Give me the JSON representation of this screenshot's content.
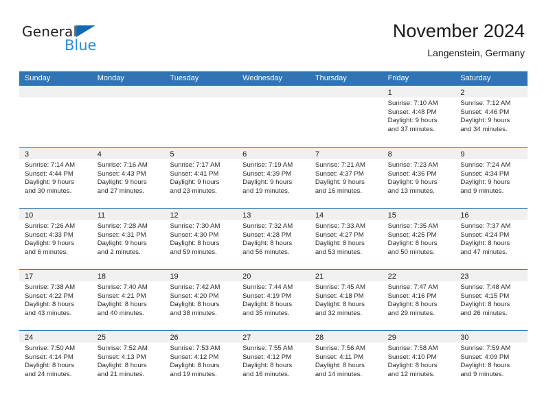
{
  "brand": {
    "word_one": "General",
    "word_two": "Blue"
  },
  "header": {
    "title": "November 2024",
    "location": "Langenstein, Germany"
  },
  "colors": {
    "header_blue": "#3174b4",
    "brand_blue": "#2e8bd4",
    "logo_triangle": "#1369b0",
    "day_band_gray": "#f0f0f0"
  },
  "weekdays": [
    "Sunday",
    "Monday",
    "Tuesday",
    "Wednesday",
    "Thursday",
    "Friday",
    "Saturday"
  ],
  "weeks": [
    [
      {
        "day": "",
        "lines": []
      },
      {
        "day": "",
        "lines": []
      },
      {
        "day": "",
        "lines": []
      },
      {
        "day": "",
        "lines": []
      },
      {
        "day": "",
        "lines": []
      },
      {
        "day": "1",
        "lines": [
          "Sunrise: 7:10 AM",
          "Sunset: 4:48 PM",
          "Daylight: 9 hours",
          "and 37 minutes."
        ]
      },
      {
        "day": "2",
        "lines": [
          "Sunrise: 7:12 AM",
          "Sunset: 4:46 PM",
          "Daylight: 9 hours",
          "and 34 minutes."
        ]
      }
    ],
    [
      {
        "day": "3",
        "lines": [
          "Sunrise: 7:14 AM",
          "Sunset: 4:44 PM",
          "Daylight: 9 hours",
          "and 30 minutes."
        ]
      },
      {
        "day": "4",
        "lines": [
          "Sunrise: 7:16 AM",
          "Sunset: 4:43 PM",
          "Daylight: 9 hours",
          "and 27 minutes."
        ]
      },
      {
        "day": "5",
        "lines": [
          "Sunrise: 7:17 AM",
          "Sunset: 4:41 PM",
          "Daylight: 9 hours",
          "and 23 minutes."
        ]
      },
      {
        "day": "6",
        "lines": [
          "Sunrise: 7:19 AM",
          "Sunset: 4:39 PM",
          "Daylight: 9 hours",
          "and 19 minutes."
        ]
      },
      {
        "day": "7",
        "lines": [
          "Sunrise: 7:21 AM",
          "Sunset: 4:37 PM",
          "Daylight: 9 hours",
          "and 16 minutes."
        ]
      },
      {
        "day": "8",
        "lines": [
          "Sunrise: 7:23 AM",
          "Sunset: 4:36 PM",
          "Daylight: 9 hours",
          "and 13 minutes."
        ]
      },
      {
        "day": "9",
        "lines": [
          "Sunrise: 7:24 AM",
          "Sunset: 4:34 PM",
          "Daylight: 9 hours",
          "and 9 minutes."
        ]
      }
    ],
    [
      {
        "day": "10",
        "lines": [
          "Sunrise: 7:26 AM",
          "Sunset: 4:33 PM",
          "Daylight: 9 hours",
          "and 6 minutes."
        ]
      },
      {
        "day": "11",
        "lines": [
          "Sunrise: 7:28 AM",
          "Sunset: 4:31 PM",
          "Daylight: 9 hours",
          "and 2 minutes."
        ]
      },
      {
        "day": "12",
        "lines": [
          "Sunrise: 7:30 AM",
          "Sunset: 4:30 PM",
          "Daylight: 8 hours",
          "and 59 minutes."
        ]
      },
      {
        "day": "13",
        "lines": [
          "Sunrise: 7:32 AM",
          "Sunset: 4:28 PM",
          "Daylight: 8 hours",
          "and 56 minutes."
        ]
      },
      {
        "day": "14",
        "lines": [
          "Sunrise: 7:33 AM",
          "Sunset: 4:27 PM",
          "Daylight: 8 hours",
          "and 53 minutes."
        ]
      },
      {
        "day": "15",
        "lines": [
          "Sunrise: 7:35 AM",
          "Sunset: 4:25 PM",
          "Daylight: 8 hours",
          "and 50 minutes."
        ]
      },
      {
        "day": "16",
        "lines": [
          "Sunrise: 7:37 AM",
          "Sunset: 4:24 PM",
          "Daylight: 8 hours",
          "and 47 minutes."
        ]
      }
    ],
    [
      {
        "day": "17",
        "lines": [
          "Sunrise: 7:38 AM",
          "Sunset: 4:22 PM",
          "Daylight: 8 hours",
          "and 43 minutes."
        ]
      },
      {
        "day": "18",
        "lines": [
          "Sunrise: 7:40 AM",
          "Sunset: 4:21 PM",
          "Daylight: 8 hours",
          "and 40 minutes."
        ]
      },
      {
        "day": "19",
        "lines": [
          "Sunrise: 7:42 AM",
          "Sunset: 4:20 PM",
          "Daylight: 8 hours",
          "and 38 minutes."
        ]
      },
      {
        "day": "20",
        "lines": [
          "Sunrise: 7:44 AM",
          "Sunset: 4:19 PM",
          "Daylight: 8 hours",
          "and 35 minutes."
        ]
      },
      {
        "day": "21",
        "lines": [
          "Sunrise: 7:45 AM",
          "Sunset: 4:18 PM",
          "Daylight: 8 hours",
          "and 32 minutes."
        ]
      },
      {
        "day": "22",
        "lines": [
          "Sunrise: 7:47 AM",
          "Sunset: 4:16 PM",
          "Daylight: 8 hours",
          "and 29 minutes."
        ]
      },
      {
        "day": "23",
        "lines": [
          "Sunrise: 7:48 AM",
          "Sunset: 4:15 PM",
          "Daylight: 8 hours",
          "and 26 minutes."
        ]
      }
    ],
    [
      {
        "day": "24",
        "lines": [
          "Sunrise: 7:50 AM",
          "Sunset: 4:14 PM",
          "Daylight: 8 hours",
          "and 24 minutes."
        ]
      },
      {
        "day": "25",
        "lines": [
          "Sunrise: 7:52 AM",
          "Sunset: 4:13 PM",
          "Daylight: 8 hours",
          "and 21 minutes."
        ]
      },
      {
        "day": "26",
        "lines": [
          "Sunrise: 7:53 AM",
          "Sunset: 4:12 PM",
          "Daylight: 8 hours",
          "and 19 minutes."
        ]
      },
      {
        "day": "27",
        "lines": [
          "Sunrise: 7:55 AM",
          "Sunset: 4:12 PM",
          "Daylight: 8 hours",
          "and 16 minutes."
        ]
      },
      {
        "day": "28",
        "lines": [
          "Sunrise: 7:56 AM",
          "Sunset: 4:11 PM",
          "Daylight: 8 hours",
          "and 14 minutes."
        ]
      },
      {
        "day": "29",
        "lines": [
          "Sunrise: 7:58 AM",
          "Sunset: 4:10 PM",
          "Daylight: 8 hours",
          "and 12 minutes."
        ]
      },
      {
        "day": "30",
        "lines": [
          "Sunrise: 7:59 AM",
          "Sunset: 4:09 PM",
          "Daylight: 8 hours",
          "and 9 minutes."
        ]
      }
    ]
  ]
}
